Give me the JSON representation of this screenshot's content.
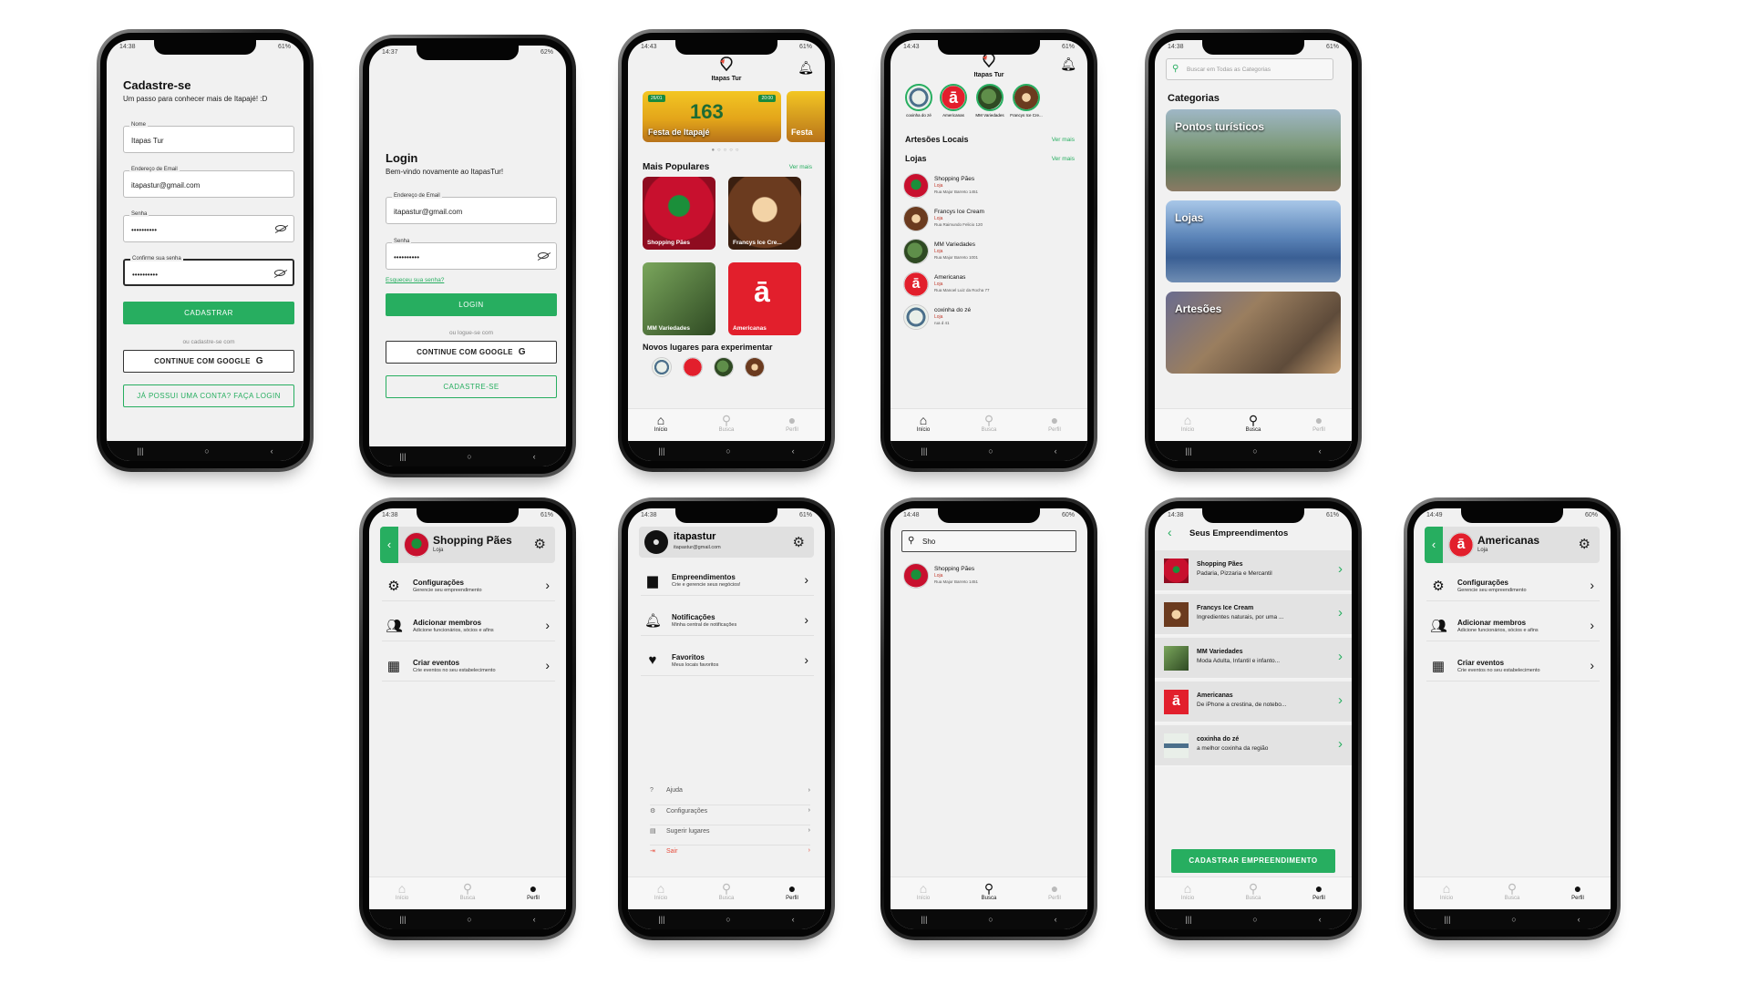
{
  "status": {
    "s1": {
      "time": "14:38",
      "info": "61%"
    },
    "s2": {
      "time": "14:37",
      "info": "62%"
    },
    "s3": {
      "time": "14:43",
      "info": "61%"
    },
    "s4": {
      "time": "14:43",
      "info": "61%"
    },
    "s5": {
      "time": "14:38",
      "info": "61%"
    },
    "s6": {
      "time": "14:38",
      "info": "61%"
    },
    "s7": {
      "time": "14:38",
      "info": "61%"
    },
    "s8": {
      "time": "14:48",
      "info": "60%"
    },
    "s9": {
      "time": "14:38",
      "info": "61%"
    },
    "s10": {
      "time": "14:49",
      "info": "60%"
    }
  },
  "tabs": {
    "home": "Início",
    "search": "Busca",
    "profile": "Perfil"
  },
  "signup": {
    "title": "Cadastre-se",
    "subtitle": "Um passo para conhecer mais de Itapajé! :D",
    "name_label": "Nome",
    "name_value": "Itapas Tur",
    "email_label": "Endereço de Email",
    "email_value": "itapastur@gmail.com",
    "password_label": "Senha",
    "password_value": "••••••••••",
    "confirm_label": "Confirme sua senha",
    "confirm_value": "••••••••••",
    "register_button": "CADASTRAR",
    "divider": "ou cadastre-se com",
    "google_button": "CONTINUE COM GOOGLE",
    "login_link_button": "JÁ POSSUI UMA CONTA? FAÇA LOGIN"
  },
  "login": {
    "title": "Login",
    "subtitle": "Bem-vindo novamente ao ItapasTur!",
    "email_label": "Endereço de Email",
    "email_value": "itapastur@gmail.com",
    "password_label": "Senha",
    "password_value": "••••••••••",
    "forgot": "Esqueceu sua senha?",
    "login_button": "LOGIN",
    "divider": "ou logue-se com",
    "google_button": "CONTINUE COM GOOGLE",
    "signup_button": "CADASTRE-SE"
  },
  "home": {
    "brand": "Itapas Tur",
    "banner_title": "Festa de Itapajé",
    "banner_title_next": "Festa",
    "banner_badge_left": "26/01",
    "banner_badge_right": "20:00",
    "banner_number": "163",
    "popular_title": "Mais Populares",
    "see_more": "Ver mais",
    "popular": [
      "Shopping Pães",
      "Francys Ice Cre...",
      "MM Variedades",
      "Americanas"
    ],
    "new_places_title": "Novos lugares para experimentar"
  },
  "home2": {
    "brand": "Itapas Tur",
    "stories": [
      "coxinha do zé",
      "Americanas",
      "MM Variedades",
      "Francys Ice Cre..."
    ],
    "artisans_title": "Artesões Locais",
    "stores_title": "Lojas",
    "see_more": "Ver mais",
    "stores": [
      {
        "name": "Shopping Pães",
        "type": "Loja",
        "addr": "Rua Major Barreto 1451"
      },
      {
        "name": "Francys Ice Cream",
        "type": "Loja",
        "addr": "Rua Raimundo Felicio 120"
      },
      {
        "name": "MM Variedades",
        "type": "Loja",
        "addr": "Rua Major Barreto 1001"
      },
      {
        "name": "Americanas",
        "type": "Loja",
        "addr": "Rua Manoel Luiz da Rocha 77"
      },
      {
        "name": "coxinha do zé",
        "type": "Loja",
        "addr": "rua d 41"
      }
    ]
  },
  "categories": {
    "search_placeholder": "Buscar em Todas as Categorias",
    "title": "Categorias",
    "items": [
      "Pontos turísticos",
      "Lojas",
      "Artesões"
    ]
  },
  "shop_profile": {
    "name": "Shopping Pães",
    "type": "Loja",
    "menu": [
      {
        "title": "Configurações",
        "sub": "Gerencie seu empreendimento"
      },
      {
        "title": "Adicionar membros",
        "sub": "Adicione funcionários, sócios e afins"
      },
      {
        "title": "Criar eventos",
        "sub": "Crie eventos no seu estabelecimento"
      }
    ]
  },
  "user_profile": {
    "name": "itapastur",
    "email": "itapastur@gmail.com",
    "menu": [
      {
        "title": "Empreendimentos",
        "sub": "Crie e gerencie seus negócios!"
      },
      {
        "title": "Notificações",
        "sub": "Minha central de notificações"
      },
      {
        "title": "Favoritos",
        "sub": "Meus locais favoritos"
      }
    ],
    "footer": [
      "Ajuda",
      "Configurações",
      "Sugerir lugares",
      "Sair"
    ]
  },
  "search": {
    "query": "Sho",
    "result": {
      "name": "Shopping Pães",
      "type": "Loja",
      "addr": "Rua Major Barreto 1451"
    }
  },
  "businesses": {
    "title": "Seus Empreendimentos",
    "items": [
      {
        "name": "Shopping Pães",
        "desc": "Padaria, Pizzaria e Mercantil"
      },
      {
        "name": "Francys Ice Cream",
        "desc": "Ingredientes naturais, por uma ..."
      },
      {
        "name": "MM Variedades",
        "desc": "Moda Adulta, Infantil e infanto..."
      },
      {
        "name": "Americanas",
        "desc": "De iPhone a crestina, de notebo..."
      },
      {
        "name": "coxinha do zé",
        "desc": "a melhor coxinha da região"
      }
    ],
    "register_button": "CADASTRAR EMPREENDIMENTO"
  },
  "am_profile": {
    "name": "Americanas",
    "type": "Loja",
    "menu": [
      {
        "title": "Configurações",
        "sub": "Gerencie seu empreendimento"
      },
      {
        "title": "Adicionar membros",
        "sub": "Adicione funcionários, sócios e afins"
      },
      {
        "title": "Criar eventos",
        "sub": "Crie eventos no seu estabelecimento"
      }
    ]
  },
  "colors": {
    "accent": "#27ae60",
    "danger": "#e74c3c",
    "americanas": "#e21f2c"
  }
}
